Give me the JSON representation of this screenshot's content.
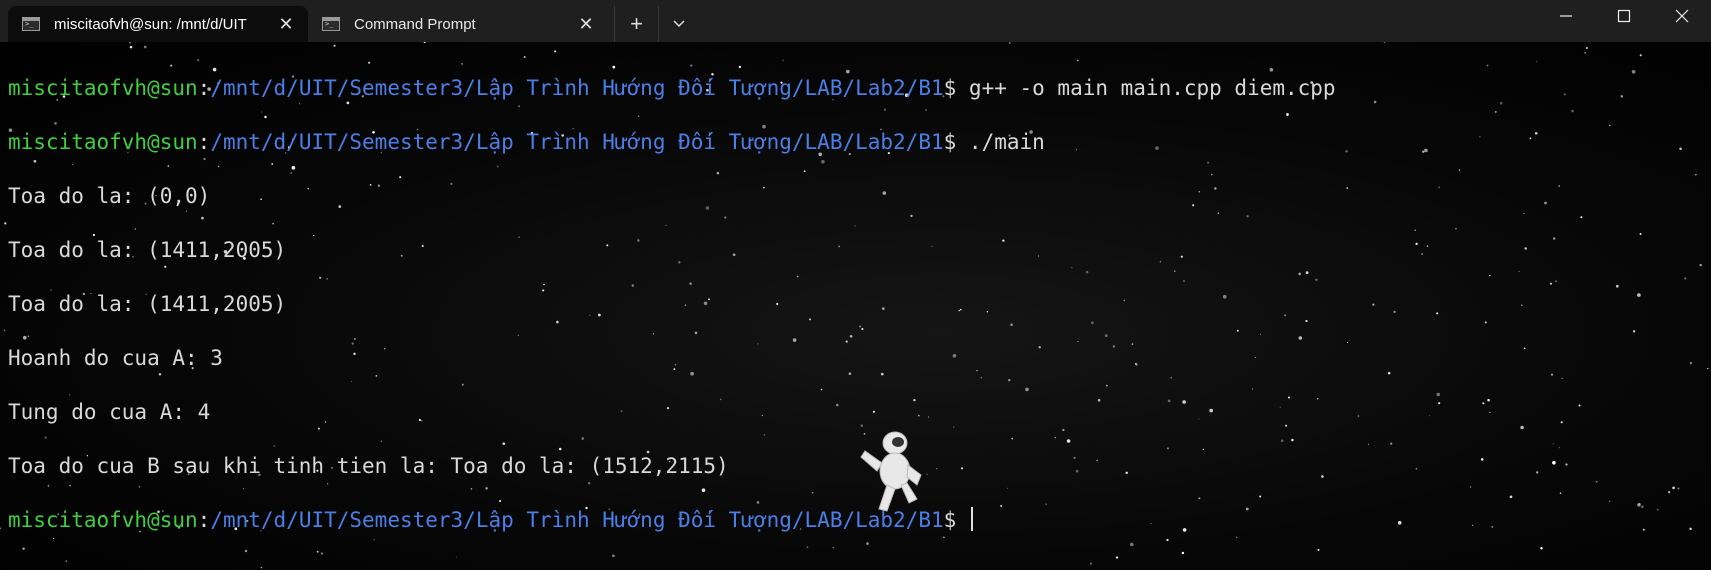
{
  "tabs": [
    {
      "title": "miscitaofvh@sun: /mnt/d/UIT",
      "active": true
    },
    {
      "title": "Command Prompt",
      "active": false
    }
  ],
  "terminal": {
    "prompts": [
      {
        "user": "miscitaofvh@sun",
        "sep": ":",
        "path": "/mnt/d/UIT/Semester3/Lập Trình Hướng Đối Tượng/LAB/Lab2/B1",
        "symbol": "$ ",
        "command": "g++ -o main main.cpp diem.cpp"
      },
      {
        "user": "miscitaofvh@sun",
        "sep": ":",
        "path": "/mnt/d/UIT/Semester3/Lập Trình Hướng Đối Tượng/LAB/Lab2/B1",
        "symbol": "$ ",
        "command": "./main"
      },
      {
        "user": "miscitaofvh@sun",
        "sep": ":",
        "path": "/mnt/d/UIT/Semester3/Lập Trình Hướng Đối Tượng/LAB/Lab2/B1",
        "symbol": "$ ",
        "command": ""
      }
    ],
    "output": [
      "Toa do la: (0,0)",
      "Toa do la: (1411,2005)",
      "Toa do la: (1411,2005)",
      "Hoanh do cua A: 3",
      "Tung do cua A: 4",
      "Toa do cua B sau khi tinh tien la: Toa do la: (1512,2115)"
    ]
  },
  "icons": {
    "terminal": "terminal-icon",
    "close": "close-icon",
    "new_tab": "plus-icon",
    "dropdown": "chevron-down-icon",
    "minimize": "minimize-icon",
    "maximize": "maximize-icon",
    "window_close": "window-close-icon"
  },
  "colors": {
    "user": "#3fcf3f",
    "path": "#4a7fe8",
    "text": "#d9d9d9",
    "background": "#000000"
  }
}
